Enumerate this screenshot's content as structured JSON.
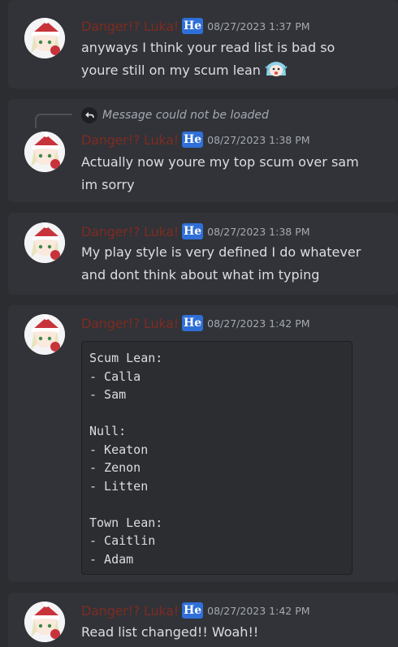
{
  "user": {
    "name": "Danger!? Luka!",
    "tag": "He",
    "name_color": "#7e2b22",
    "tag_color": "#2f6fd8"
  },
  "messages": [
    {
      "timestamp": "08/27/2023 1:37 PM",
      "text": "anyways I think your read list is bad so youre still on my scum lean",
      "emoji": "crying-anime-girl-emoji"
    },
    {
      "reply": "Message could not be loaded",
      "timestamp": "08/27/2023 1:38 PM",
      "text": "Actually now youre my top scum over sam im sorry"
    },
    {
      "timestamp": "08/27/2023 1:38 PM",
      "text": "My play style is very defined I do whatever and dont think about what im typing"
    },
    {
      "timestamp": "08/27/2023 1:42 PM",
      "code": "Scum Lean:\n- Calla\n- Sam\n\nNull:\n- Keaton\n- Zenon\n- Litten\n\nTown Lean:\n- Caitlin\n- Adam"
    },
    {
      "timestamp": "08/27/2023 1:42 PM",
      "text": "Read list changed!! Woah!!"
    }
  ]
}
